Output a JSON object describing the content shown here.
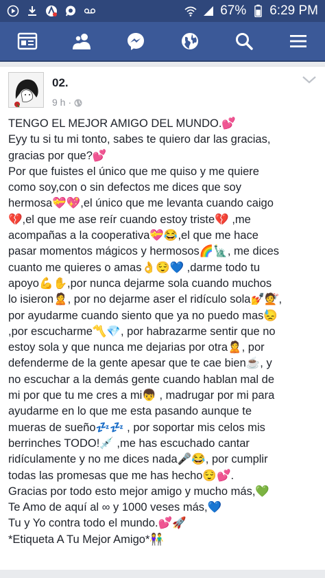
{
  "status_bar": {
    "battery_percent": "67%",
    "time": "6:29 PM",
    "icons": [
      "play-icon",
      "download-icon",
      "vpn-icon",
      "whatsapp-icon",
      "voicemail-icon",
      "wifi-icon",
      "signal-icon",
      "battery-icon"
    ]
  },
  "nav": {
    "items": [
      "news-feed-icon",
      "friends-icon",
      "messenger-icon",
      "globe-notifications-icon",
      "search-icon",
      "menu-icon"
    ]
  },
  "post": {
    "author": "02.",
    "time": "9 h",
    "lines": [
      "TENGO EL MEJOR AMIGO DEL MUNDO.💕",
      "Eyy tu si tu mi tonto, sabes te quiero dar las gracias,",
      "gracias por que?💕",
      "Por que fuistes el único que me quiso y me quiere",
      "como soy,con o sin defectos me dices que soy",
      "hermosa💝💖,el único que me levanta cuando caigo",
      "💔,el que me ase reír cuando estoy triste💔 ,me",
      "acompañas a la cooperativa💝😂,el que me hace",
      "pasar momentos mágicos y hermosos🌈🗽, me dices",
      "cuanto me quieres o amas👌😌💙 ,darme todo tu",
      "apoyo💪✋,por nunca dejarme sola cuando muchos",
      "lo isieron🙎, por no dejarme aser el ridículo sola💅💇,",
      "por ayudarme cuando siento que ya no puedo mas😓",
      ",por escucharme〽️💎, por habrazarme sentir que no",
      "estoy sola y que nunca me dejarias por otra🙎, por",
      "defenderme de la gente apesar que te cae bien☕, y",
      "no escuchar a la demás gente cuando hablan mal de",
      "mi por que tu me cres a mi👦 , madrugar por mi para",
      "ayudarme en lo que me esta pasando aunque te",
      "mueras de sueño💤💤 , por soportar mis celos mis",
      "berrinches TODO!💉 ,me has escuchado cantar",
      "ridículamente y no me dices nada🎤😂, por cumplir",
      "todas las promesas que me has hecho😌💕.",
      "Gracias por todo esto mejor amigo y mucho más,💚",
      "Te Amo de aquí al ∞ y 1000 veses más,💙",
      "Tu y Yo contra todo el mundo.💕🚀",
      "*Etiqueta A Tu Mejor Amigo*👫"
    ]
  }
}
